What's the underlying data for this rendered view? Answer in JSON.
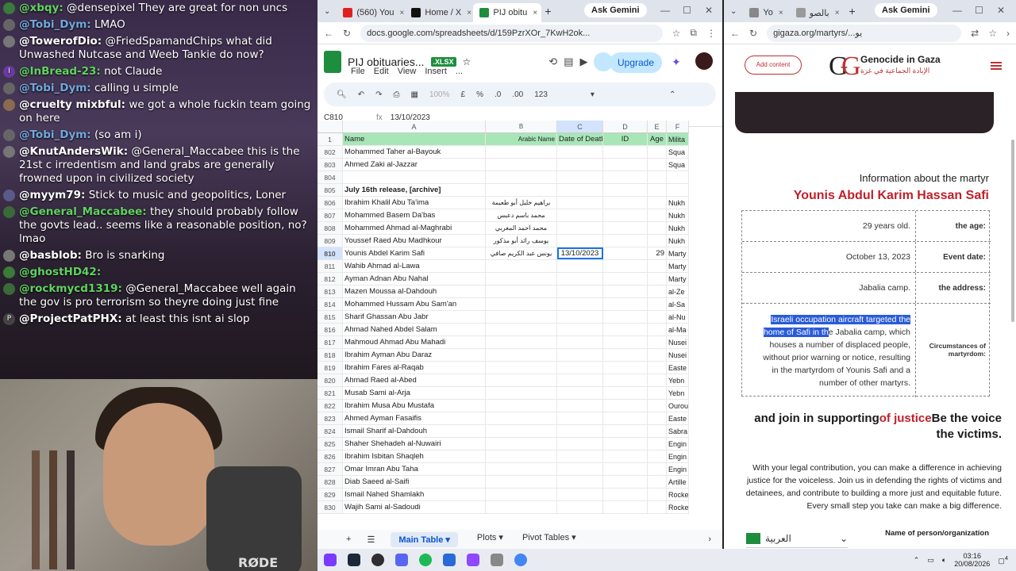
{
  "chat": [
    {
      "user": "@xbqy:",
      "text": "@densepixel They are great for non uncs",
      "color": "#5fd35f",
      "av": "#3a7a3a"
    },
    {
      "user": "@Tobi_Dym:",
      "text": "LMAO",
      "color": "#6fa8dc",
      "av": "#666"
    },
    {
      "user": "@TowerofDio:",
      "text": "@FriedSpamandChips what did Unwashed Nutcase and Weeb Tankie do now?",
      "color": "#ffffff",
      "av": "#777"
    },
    {
      "user": "@InBread-23:",
      "text": "not Claude",
      "color": "#5fd35f",
      "av": "#6a3aa0",
      "avtext": "I"
    },
    {
      "user": "@Tobi_Dym:",
      "text": "calling u simple",
      "color": "#6fa8dc",
      "av": "#666"
    },
    {
      "user": "@cruelty mixbful:",
      "text": "we got a whole fuckin team going on here",
      "color": "#ffffff",
      "av": "#8a6a50"
    },
    {
      "user": "@Tobi_Dym:",
      "text": "(so am i)",
      "color": "#6fa8dc",
      "av": "#666"
    },
    {
      "user": "@KnutAndersWik:",
      "text": "@General_Maccabee this is the 21st c irredentism and land grabs are generally frowned upon in civilized society",
      "color": "#ffffff",
      "av": "#777"
    },
    {
      "user": "@myym79:",
      "text": "Stick to music and geopolitics, Loner",
      "color": "#ffffff",
      "av": "#5a5a8a"
    },
    {
      "user": "@General_Maccabee:",
      "text": "they should probably follow the govts lead.. seems like a reasonable position, no? lmao",
      "color": "#5fd35f",
      "av": "#3a6a3a"
    },
    {
      "user": "@basblob:",
      "text": "Bro is snarking",
      "color": "#ffffff",
      "av": "#777"
    },
    {
      "user": "@ghostHD42:",
      "text": "",
      "color": "#5fd35f",
      "av": "#3a7a3a"
    },
    {
      "user": "@rockmycd1319:",
      "text": "@General_Maccabee well again the gov is pro terrorism so theyre doing just fine",
      "color": "#5fd35f",
      "av": "#3a6a3a"
    },
    {
      "user": "@ProjectPatPHX:",
      "text": "at least this isnt ai slop",
      "color": "#ffffff",
      "av": "#444",
      "avtext": "P"
    }
  ],
  "webcam": {
    "mic_brand": "RØDE"
  },
  "sheets_window": {
    "tabs": [
      {
        "label": "(560) You",
        "icon_color": "#e02020"
      },
      {
        "label": "Home / X",
        "icon_color": "#111111"
      },
      {
        "label": "PIJ obitu",
        "icon_color": "#1e8e3e",
        "active": true
      }
    ],
    "gemini": "Ask Gemini",
    "url": "docs.google.com/spreadsheets/d/159PzrXOr_7KwH2ok...",
    "doc_title": "PIJ obituaries...",
    "badge": ".XLSX",
    "menus": [
      "File",
      "Edit",
      "View",
      "Insert",
      "..."
    ],
    "upgrade": "Upgrade",
    "toolbar": {
      "zoom": "100%",
      "currency": "£",
      "percent": "%",
      "dec1": ".0",
      "dec2": ".00",
      "numfmt": "123"
    },
    "cell_ref": "C810",
    "formula": "13/10/2023",
    "columns": [
      "A",
      "B",
      "C",
      "D",
      "E",
      "F"
    ],
    "header_row": {
      "num": "1",
      "name": "Name",
      "arabic": "Arabic Name",
      "date": "Date of Death",
      "id": "ID",
      "age": "Age",
      "mil": "Milita"
    },
    "rows": [
      {
        "n": "802",
        "a": "Mohammed Taher al-Bayouk",
        "b": "",
        "c": "",
        "d": "",
        "e": "",
        "f": "Squa"
      },
      {
        "n": "803",
        "a": "Ahmed Zaki al-Jazzar",
        "b": "",
        "c": "",
        "d": "",
        "e": "",
        "f": "Squa"
      },
      {
        "n": "804",
        "a": "",
        "b": "",
        "c": "",
        "d": "",
        "e": "",
        "f": ""
      },
      {
        "n": "805",
        "a": "July 16th release, [archive]",
        "b": "",
        "c": "",
        "d": "",
        "e": "",
        "f": "",
        "bold": true
      },
      {
        "n": "806",
        "a": "Ibrahim Khalil Abu Ta'ima",
        "b": "براهيم خليل أبو طعيمة",
        "c": "",
        "d": "",
        "e": "",
        "f": "Nukh"
      },
      {
        "n": "807",
        "a": "Mohammed Basem Da'bas",
        "b": "محمد باسم دعبس",
        "c": "",
        "d": "",
        "e": "",
        "f": "Nukh"
      },
      {
        "n": "808",
        "a": "Mohammed Ahmad al-Maghrabi",
        "b": "محمد احمد المغربي",
        "c": "",
        "d": "",
        "e": "",
        "f": "Nukh"
      },
      {
        "n": "809",
        "a": "Youssef Raed Abu Madhkour",
        "b": "يوسف رائد أبو مذكور",
        "c": "",
        "d": "",
        "e": "",
        "f": "Nukh"
      },
      {
        "n": "810",
        "a": "Younis Abdel Karim Safi",
        "b": "يونس عبد الكريم صافي",
        "c": "13/10/2023",
        "d": "",
        "e": "29",
        "f": "Marty",
        "sel": true
      },
      {
        "n": "811",
        "a": "Wahib Ahmad al-Lawa",
        "b": "",
        "c": "",
        "d": "",
        "e": "",
        "f": "Marty"
      },
      {
        "n": "812",
        "a": "Ayman Adnan Abu Nahal",
        "b": "",
        "c": "",
        "d": "",
        "e": "",
        "f": "Marty"
      },
      {
        "n": "813",
        "a": "Mazen Moussa al-Dahdouh",
        "b": "",
        "c": "",
        "d": "",
        "e": "",
        "f": "al-Ze"
      },
      {
        "n": "814",
        "a": "Mohammed Hussam Abu Sam'an",
        "b": "",
        "c": "",
        "d": "",
        "e": "",
        "f": "al-Sa"
      },
      {
        "n": "815",
        "a": "Sharif Ghassan Abu Jabr",
        "b": "",
        "c": "",
        "d": "",
        "e": "",
        "f": "al-Nu"
      },
      {
        "n": "816",
        "a": "Ahmad Nahed Abdel Salam",
        "b": "",
        "c": "",
        "d": "",
        "e": "",
        "f": "al-Ma"
      },
      {
        "n": "817",
        "a": "Mahmoud Ahmad Abu Mahadi",
        "b": "",
        "c": "",
        "d": "",
        "e": "",
        "f": "Nusei"
      },
      {
        "n": "818",
        "a": "Ibrahim Ayman Abu Daraz",
        "b": "",
        "c": "",
        "d": "",
        "e": "",
        "f": "Nusei"
      },
      {
        "n": "819",
        "a": "Ibrahim Fares al-Raqab",
        "b": "",
        "c": "",
        "d": "",
        "e": "",
        "f": "Easte"
      },
      {
        "n": "820",
        "a": "Ahmad Raed al-Abed",
        "b": "",
        "c": "",
        "d": "",
        "e": "",
        "f": "Yebn"
      },
      {
        "n": "821",
        "a": "Musab Sami al-Arja",
        "b": "",
        "c": "",
        "d": "",
        "e": "",
        "f": "Yebn"
      },
      {
        "n": "822",
        "a": "Ibrahim Musa Abu Mustafa",
        "b": "",
        "c": "",
        "d": "",
        "e": "",
        "f": "Ourou"
      },
      {
        "n": "823",
        "a": "Ahmed Ayman Fasaifis",
        "b": "",
        "c": "",
        "d": "",
        "e": "",
        "f": "Easte"
      },
      {
        "n": "824",
        "a": "Ismail Sharif al-Dahdouh",
        "b": "",
        "c": "",
        "d": "",
        "e": "",
        "f": "Sabra"
      },
      {
        "n": "825",
        "a": "Shaher Shehadeh al-Nuwairi",
        "b": "",
        "c": "",
        "d": "",
        "e": "",
        "f": "Engin"
      },
      {
        "n": "826",
        "a": "Ibrahim Isbitan Shaqleh",
        "b": "",
        "c": "",
        "d": "",
        "e": "",
        "f": "Engin"
      },
      {
        "n": "827",
        "a": "Omar Imran Abu Taha",
        "b": "",
        "c": "",
        "d": "",
        "e": "",
        "f": "Engin"
      },
      {
        "n": "828",
        "a": "Diab Saeed al-Saifi",
        "b": "",
        "c": "",
        "d": "",
        "e": "",
        "f": "Artille"
      },
      {
        "n": "829",
        "a": "Ismail Nahed Shamlakh",
        "b": "",
        "c": "",
        "d": "",
        "e": "",
        "f": "Rocke"
      },
      {
        "n": "830",
        "a": "Wajih Sami al-Sadoudi",
        "b": "",
        "c": "",
        "d": "",
        "e": "",
        "f": "Rocke"
      }
    ],
    "sheet_tabs": [
      "Main Table",
      "Plots",
      "Pivot Tables"
    ]
  },
  "gaza_window": {
    "tabs": [
      {
        "label": "Yo",
        "icon_color": "#888"
      },
      {
        "label": "بالصو",
        "icon_color": "#999"
      }
    ],
    "gemini": "Ask Gemini",
    "url": "gigaza.org/martyrs/...يو",
    "add_content": "Add content",
    "logo_text": "Genocide in Gaza",
    "logo_arabic": "الإبادة الجماعية في غزة",
    "info_heading": "Information about the martyr",
    "martyr_name": "Younis Abdul Karim Hassan Safi",
    "fields": [
      {
        "value": "29 years old.",
        "label": "the age:"
      },
      {
        "value": "October 13, 2023",
        "label": "Event date:"
      },
      {
        "value": "Jabalia camp.",
        "label": "the address:"
      }
    ],
    "circ_label": "Circumstances of martyrdom:",
    "circ_hl1": "Israeli occupation aircraft targeted the",
    "circ_hl2": "home of Safi in th",
    "circ_rest1": "e Jabalia camp, which",
    "circ_rest2": "houses a number of displaced people, without prior warning or notice, resulting in the martyrdom of Younis Safi and a number of other martyrs.",
    "join1": "and join in supporting",
    "join2": "of justice",
    "join3": "Be the voice the victims.",
    "paragraph": "With your legal contribution, you can make a difference in achieving justice for the voiceless. Join us in defending the rights of victims and detainees, and contribute to building a more just and equitable future. Every small step you take can make a big difference.",
    "name_org": "Name of person/organization",
    "lang": "العربية"
  },
  "taskbar": {
    "time": "03:16",
    "date": "20/08/2026",
    "notif": "4"
  }
}
